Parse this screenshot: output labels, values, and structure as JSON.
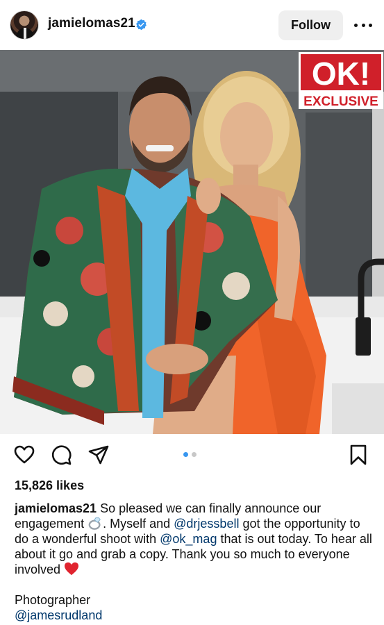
{
  "header": {
    "username": "jamielomas21",
    "follow_label": "Follow",
    "verified_icon": "verified-badge-icon",
    "more_icon": "more-options-icon"
  },
  "photo": {
    "badge_brand": "OK!",
    "badge_sub": "EXCLUSIVE",
    "carousel_count": 2,
    "carousel_active": 1
  },
  "actions": {
    "icons": [
      "heart-icon",
      "comment-icon",
      "share-icon",
      "bookmark-icon"
    ]
  },
  "likes": "15,826 likes",
  "caption": {
    "username": "jamielomas21",
    "text_1": " So pleased we can finally announce our engagement ",
    "ring_icon": "ring-emoji",
    "text_2": ". Myself and ",
    "mention_1": "@drjessbell",
    "text_3": " got the opportunity to do a wonderful shoot with ",
    "mention_2": "@ok_mag",
    "text_4": " that is out today. To hear all about it go and grab a copy. Thank you so much to everyone involved ",
    "heart_icon": "red-heart-emoji"
  },
  "credit": {
    "label": "Photographer",
    "mention": "@jamesrudland"
  },
  "colors": {
    "mention": "#00376b",
    "verified": "#3897f0",
    "follow_bg": "#efefef",
    "badge_red": "#d0202a"
  }
}
